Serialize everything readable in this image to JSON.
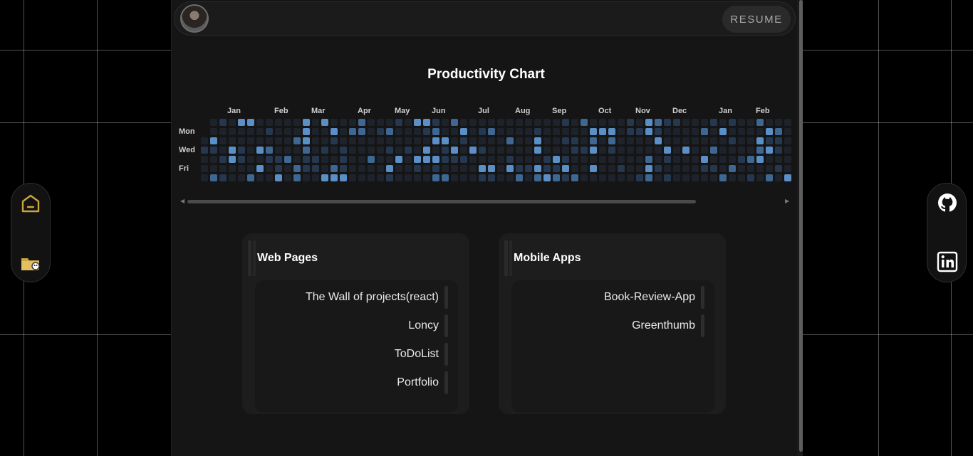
{
  "header": {
    "resume_label": "RESUME"
  },
  "productivity": {
    "title": "Productivity Chart",
    "months": [
      "Jan",
      "Feb",
      "Mar",
      "Apr",
      "May",
      "Jun",
      "Jul",
      "Aug",
      "Sep",
      "Oct",
      "Nov",
      "Dec",
      "Jan",
      "Feb"
    ],
    "days": [
      "Mon",
      "Wed",
      "Fri"
    ],
    "colors": {
      "empty": "#1e222a",
      "low": "#263850",
      "mid": "#3f6794",
      "high": "#5b8fc8"
    }
  },
  "projects": {
    "web": {
      "title": "Web Pages",
      "items": [
        "The Wall of projects(react)",
        "Loncy",
        "ToDoList",
        "Portfolio"
      ]
    },
    "mobile": {
      "title": "Mobile Apps",
      "items": [
        "Book-Review-App",
        "Greenthumb"
      ]
    }
  },
  "sidebar_left": {
    "icons": [
      "home-icon",
      "folder-icon"
    ]
  },
  "sidebar_right": {
    "icons": [
      "github-icon",
      "linkedin-icon"
    ]
  },
  "colors": {
    "accent": "#c9a53a",
    "background": "#000000",
    "panel": "#151515"
  }
}
